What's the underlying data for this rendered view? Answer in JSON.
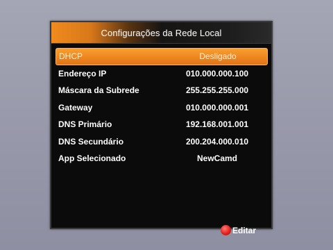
{
  "window": {
    "title": "Configurações da Rede Local"
  },
  "settings": [
    {
      "label": "DHCP",
      "value": "Desligado",
      "selected": true
    },
    {
      "label": "Endereço IP",
      "value": "010.000.000.100",
      "selected": false
    },
    {
      "label": "Máscara da Subrede",
      "value": "255.255.255.000",
      "selected": false
    },
    {
      "label": "Gateway",
      "value": "010.000.000.001",
      "selected": false
    },
    {
      "label": "DNS Primário",
      "value": "192.168.001.001",
      "selected": false
    },
    {
      "label": "DNS Secundário",
      "value": "200.204.000.010",
      "selected": false
    },
    {
      "label": "App Selecionado",
      "value": "NewCamd",
      "selected": false
    }
  ],
  "footer": {
    "red_button_label": "Editar",
    "red_button_icon": "red-button-icon"
  },
  "colors": {
    "accent": "#ee8521",
    "panel_background": "#0b0b0b",
    "screen_background": "#999aab",
    "red_button": "#e3221a"
  }
}
